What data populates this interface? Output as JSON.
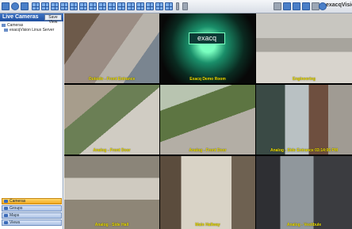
{
  "toolbar": {
    "icons": [
      "home-icon",
      "search-icon",
      "config-icon",
      "layout-1x1-icon",
      "layout-2x2-icon",
      "layout-3x3-icon",
      "layout-4x4-icon",
      "layout-custom-icon",
      "lock-icon",
      "key-icon",
      "help-icon",
      "globe-icon"
    ],
    "brand": "exacqVision"
  },
  "sidebar": {
    "title": "Live Cameras",
    "save_view": "Save View",
    "tree": [
      {
        "label": "Cameras",
        "icon": "folder-icon"
      },
      {
        "label": "exacqVision Linux Server",
        "icon": "server-icon"
      }
    ],
    "nav": [
      {
        "label": "Cameras",
        "active": true
      },
      {
        "label": "Groups",
        "active": false
      },
      {
        "label": "Maps",
        "active": false
      },
      {
        "label": "Views",
        "active": false
      }
    ]
  },
  "cameras": [
    {
      "label": "Outside - Front Entrance"
    },
    {
      "label": "Exacq Demo Room"
    },
    {
      "label": "Engineering"
    },
    {
      "label": "Analog - Front Door"
    },
    {
      "label": "Analog - Front Door"
    },
    {
      "label": "Analog - Side Entrance 03:14:06 PM"
    },
    {
      "label": "Analog - Side Hall"
    },
    {
      "label": "Main Hallway"
    },
    {
      "label": "Analog - Vestibule"
    }
  ],
  "demo_sign": {
    "text": "exacq"
  }
}
